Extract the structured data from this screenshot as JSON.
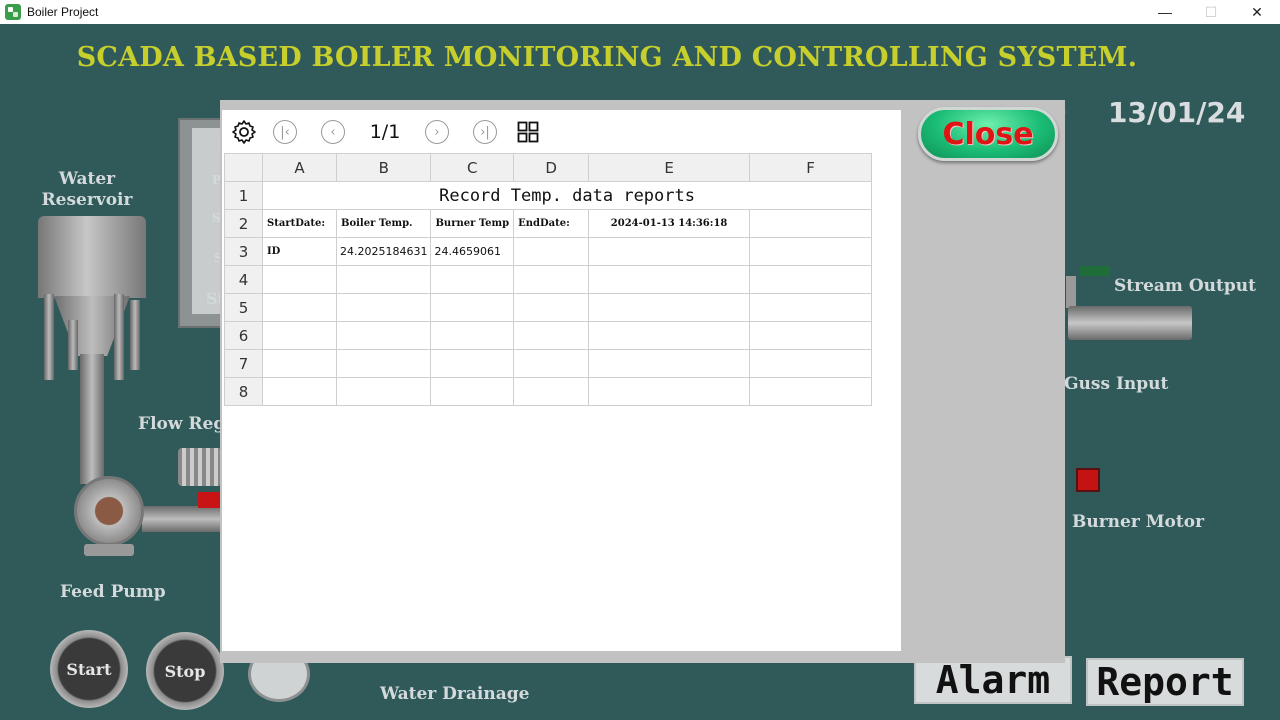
{
  "window": {
    "title": "Boiler Project",
    "minimize": "—",
    "maximize": "☐",
    "close": "✕"
  },
  "header": {
    "title": "SCADA BASED BOILER MONITORING AND CONTROLLING SYSTEM.",
    "date": "13/01/24",
    "time_fragment": "0"
  },
  "labels": {
    "water_reservoir": "Water\nReservoir",
    "flow_reg": "Flow Reg",
    "feed_pump": "Feed Pump",
    "water_drainage": "Water Drainage",
    "stream_output": "Stream Output",
    "guss_input": "Guss Input",
    "burner_motor": "Burner Motor",
    "panel_frag_1": "I",
    "panel_frag_2": "P",
    "panel_frag_3": "S",
    "panel_frag_4": "S",
    "panel_frag_5": "St"
  },
  "controls": {
    "start": "Start",
    "stop": "Stop",
    "alarm": "Alarm",
    "report": "Report"
  },
  "report": {
    "page_indicator": "1/1",
    "columns": [
      "A",
      "B",
      "C",
      "D",
      "E",
      "F"
    ],
    "row_numbers": [
      "1",
      "2",
      "3",
      "4",
      "5",
      "6",
      "7",
      "8"
    ],
    "title": "Record Temp. data reports",
    "row2": [
      "StartDate:",
      "Boiler Temp.",
      "Burner Temp",
      "EndDate:",
      "2024-01-13 14:36:18",
      ""
    ],
    "row3": [
      "ID",
      "24.2025184631",
      "24.4659061",
      "",
      "",
      ""
    ],
    "close_label": "Close"
  },
  "icons": {
    "settings": "gear-icon",
    "first": "first-page-icon",
    "prev": "prev-page-icon",
    "next": "next-page-icon",
    "last": "last-page-icon",
    "grid": "grid-view-icon"
  }
}
